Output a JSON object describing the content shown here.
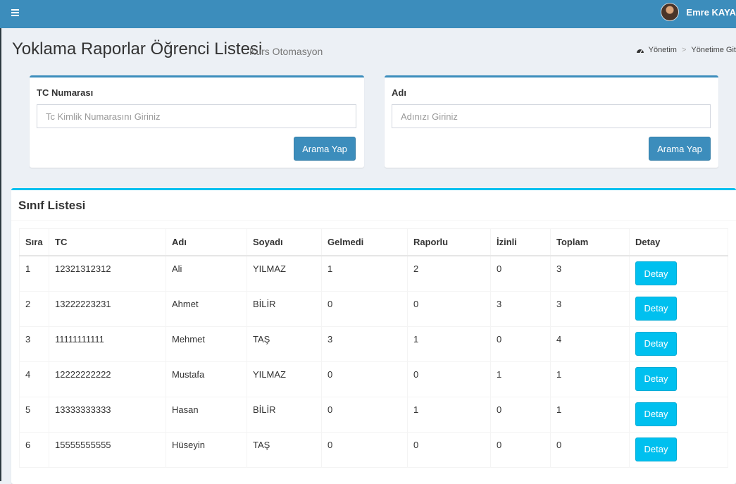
{
  "header": {
    "user_name": "Emre KAYA"
  },
  "page": {
    "title": "Yoklama Raporlar Öğrenci Listesi",
    "subtitle": "Kurs Otomasyon"
  },
  "breadcrumb": {
    "items": [
      "Yönetim",
      "Yönetime Git"
    ],
    "separator": ">"
  },
  "search_tc": {
    "label": "TC Numarası",
    "placeholder": "Tc Kimlik Numarasını Giriniz",
    "value": "",
    "button": "Arama Yap"
  },
  "search_name": {
    "label": "Adı",
    "placeholder": "Adınızı Giriniz",
    "value": "",
    "button": "Arama Yap"
  },
  "list": {
    "title": "Sınıf Listesi",
    "columns": [
      "Sıra",
      "TC",
      "Adı",
      "Soyadı",
      "Gelmedi",
      "Raporlu",
      "İzinli",
      "Toplam",
      "Detay"
    ],
    "rows": [
      {
        "sira": "1",
        "tc": "12321312312",
        "adi": "Ali",
        "soyadi": "YILMAZ",
        "gelmedi": "1",
        "raporlu": "2",
        "izinli": "0",
        "toplam": "3",
        "detay": "Detay"
      },
      {
        "sira": "2",
        "tc": "13222223231",
        "adi": "Ahmet",
        "soyadi": "BİLİR",
        "gelmedi": "0",
        "raporlu": "0",
        "izinli": "3",
        "toplam": "3",
        "detay": "Detay"
      },
      {
        "sira": "3",
        "tc": "11111111111",
        "adi": "Mehmet",
        "soyadi": "TAŞ",
        "gelmedi": "3",
        "raporlu": "1",
        "izinli": "0",
        "toplam": "4",
        "detay": "Detay"
      },
      {
        "sira": "4",
        "tc": "12222222222",
        "adi": "Mustafa",
        "soyadi": "YILMAZ",
        "gelmedi": "0",
        "raporlu": "0",
        "izinli": "1",
        "toplam": "1",
        "detay": "Detay"
      },
      {
        "sira": "5",
        "tc": "13333333333",
        "adi": "Hasan",
        "soyadi": "BİLİR",
        "gelmedi": "0",
        "raporlu": "1",
        "izinli": "0",
        "toplam": "1",
        "detay": "Detay"
      },
      {
        "sira": "6",
        "tc": "15555555555",
        "adi": "Hüseyin",
        "soyadi": "TAŞ",
        "gelmedi": "0",
        "raporlu": "0",
        "izinli": "0",
        "toplam": "0",
        "detay": "Detay"
      }
    ]
  },
  "colors": {
    "header": "#3c8dbc",
    "primary_button": "#3c8dbc",
    "info_button": "#00c0ef",
    "background": "#ecf0f5"
  },
  "icons": {
    "menu": "hamburger-icon",
    "breadcrumb": "dashboard-icon"
  }
}
